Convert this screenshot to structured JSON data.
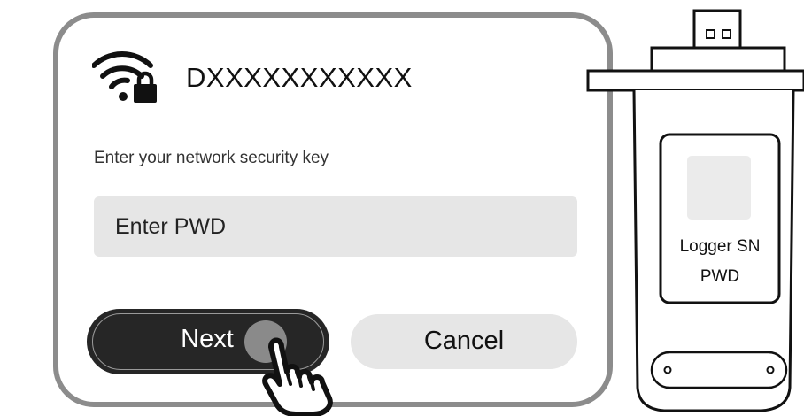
{
  "dialog": {
    "network_name": "DXXXXXXXXXXX",
    "prompt": "Enter your network security key",
    "password": {
      "placeholder": "Enter PWD",
      "value": ""
    },
    "next_label": "Next",
    "cancel_label": "Cancel"
  },
  "device": {
    "sn_label": "Logger SN",
    "pwd_label": "PWD"
  },
  "icons": {
    "network": "wifi-lock-icon",
    "pointer": "hand-pointer-icon"
  },
  "colors": {
    "primary_button": "#262626",
    "secondary_button": "#e6e6e6",
    "input_background": "#e6e6e6",
    "dialog_border": "#8c8c8c"
  }
}
